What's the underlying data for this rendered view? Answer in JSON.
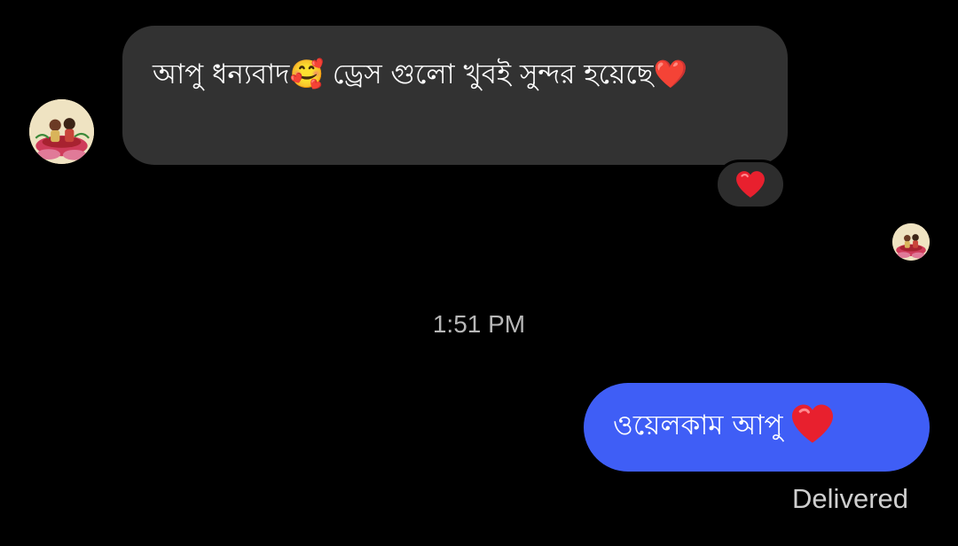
{
  "conversation": {
    "incoming_message": {
      "text": "আপু ধন্যবাদ🥰 ড্রেস গুলো খুবই সুন্দর হয়েছে❤️",
      "reaction_icon": "heart-icon"
    },
    "timestamp": "1:51 PM",
    "outgoing_message": {
      "text": "ওয়েলকাম আপু",
      "trailing_icon": "heart-icon"
    },
    "delivery_status": "Delivered"
  },
  "colors": {
    "background": "#000000",
    "incoming_bubble": "#323232",
    "outgoing_bubble": "#3f5ef6",
    "heart": "#e8202e"
  }
}
